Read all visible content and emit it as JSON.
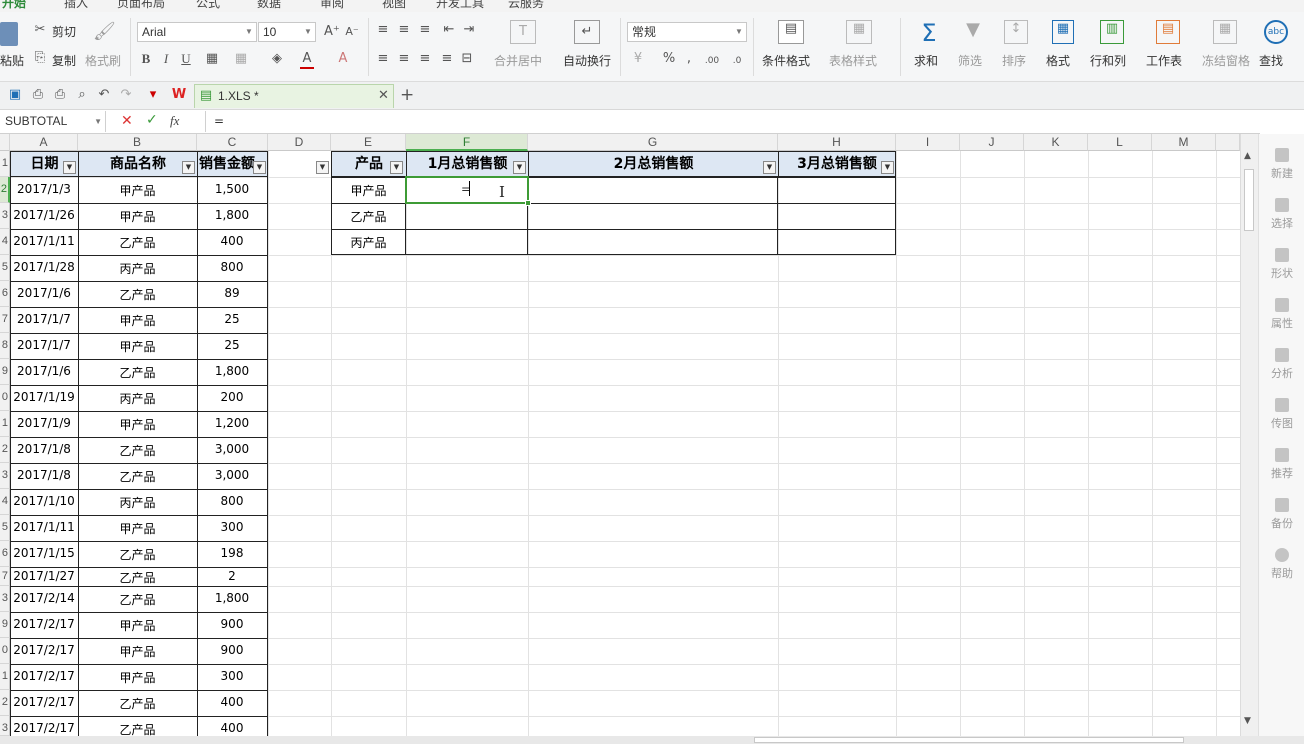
{
  "menu": {
    "tabs": [
      "开始",
      "插入",
      "页面布局",
      "公式",
      "数据",
      "审阅",
      "视图",
      "开发工具",
      "云服务"
    ]
  },
  "ribbon": {
    "paste": "粘贴",
    "cut": "剪切",
    "copy": "复制",
    "format_painter": "格式刷",
    "font_name": "Arial",
    "font_size": "10",
    "merge_center": "合并居中",
    "wrap_text": "自动换行",
    "number_format": "常规",
    "conditional_format": "条件格式",
    "table_style": "表格样式",
    "sum": "求和",
    "filter": "筛选",
    "sort": "排序",
    "format": "格式",
    "row_col": "行和列",
    "worksheet": "工作表",
    "freeze": "冻结窗格",
    "find": "查找"
  },
  "doc_tab": {
    "title": "1.XLS *"
  },
  "formula_bar": {
    "name_box": "SUBTOTAL",
    "fx": "fx",
    "value": "="
  },
  "columns": [
    "A",
    "B",
    "C",
    "D",
    "E",
    "F",
    "G",
    "H",
    "I",
    "J",
    "K",
    "L",
    "M"
  ],
  "row_numbers": [
    "",
    "1",
    "2",
    "3",
    "4",
    "5",
    "6",
    "7",
    "8",
    "9",
    "0",
    "1",
    "2",
    "3",
    "4",
    "5",
    "6",
    "7",
    "3",
    "9",
    "0",
    "1",
    "2",
    "3"
  ],
  "left_table": {
    "headers": [
      "日期",
      "商品名称",
      "销售金额"
    ],
    "rows": [
      [
        "2017/1/3",
        "甲产品",
        "1,500"
      ],
      [
        "2017/1/26",
        "甲产品",
        "1,800"
      ],
      [
        "2017/1/11",
        "乙产品",
        "400"
      ],
      [
        "2017/1/28",
        "丙产品",
        "800"
      ],
      [
        "2017/1/6",
        "乙产品",
        "89"
      ],
      [
        "2017/1/7",
        "甲产品",
        "25"
      ],
      [
        "2017/1/7",
        "甲产品",
        "25"
      ],
      [
        "2017/1/6",
        "乙产品",
        "1,800"
      ],
      [
        "2017/1/19",
        "丙产品",
        "200"
      ],
      [
        "2017/1/9",
        "甲产品",
        "1,200"
      ],
      [
        "2017/1/8",
        "乙产品",
        "3,000"
      ],
      [
        "2017/1/8",
        "乙产品",
        "3,000"
      ],
      [
        "2017/1/10",
        "丙产品",
        "800"
      ],
      [
        "2017/1/11",
        "甲产品",
        "300"
      ],
      [
        "2017/1/15",
        "乙产品",
        "198"
      ],
      [
        "2017/1/27",
        "乙产品",
        "2"
      ],
      [
        "2017/2/14",
        "乙产品",
        "1,800"
      ],
      [
        "2017/2/17",
        "甲产品",
        "900"
      ],
      [
        "2017/2/17",
        "甲产品",
        "900"
      ],
      [
        "2017/2/17",
        "甲产品",
        "300"
      ],
      [
        "2017/2/17",
        "乙产品",
        "400"
      ],
      [
        "2017/2/17",
        "乙产品",
        "400"
      ]
    ]
  },
  "right_table": {
    "headers": [
      "产品",
      "1月总销售额",
      "2月总销售额",
      "3月总销售额"
    ],
    "rows": [
      [
        "甲产品",
        "=",
        "",
        ""
      ],
      [
        "乙产品",
        "",
        "",
        ""
      ],
      [
        "丙产品",
        "",
        "",
        ""
      ]
    ]
  },
  "right_pane": [
    "新建",
    "选择",
    "形状",
    "属性",
    "分析",
    "传图",
    "推荐",
    "备份",
    "帮助"
  ]
}
